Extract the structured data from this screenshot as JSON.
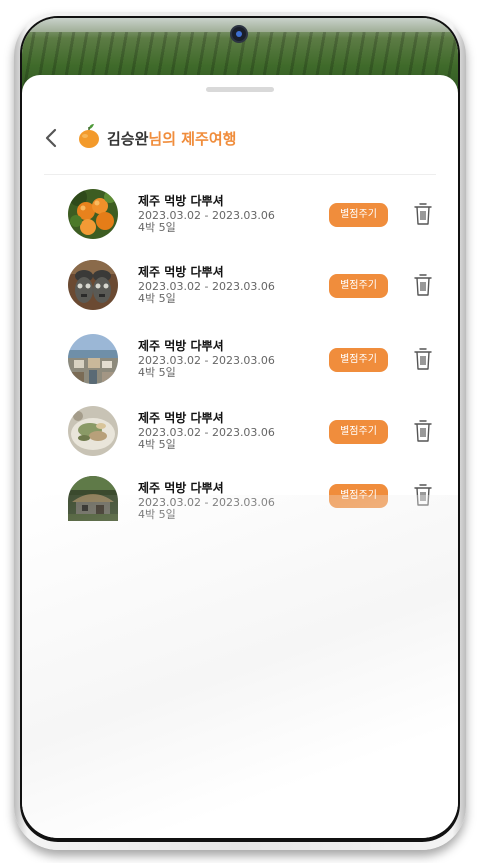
{
  "header": {
    "user_name": "김승완",
    "title_suffix": "님의 제주여행",
    "back_icon": "chevron-left-icon",
    "logo_icon": "tangerine-icon"
  },
  "trips": [
    {
      "title": "제주 먹방 다뿌셔",
      "dates": "2023.03.02 - 2023.03.06",
      "nights": "4박 5일",
      "rate_label": "별점주기",
      "image": "tangerines-photo"
    },
    {
      "title": "제주 먹방 다뿌셔",
      "dates": "2023.03.02 - 2023.03.06",
      "nights": "4박 5일",
      "rate_label": "별점주기",
      "image": "dol-hareubang-photo"
    },
    {
      "title": "제주 먹방 다뿌셔",
      "dates": "2023.03.02 - 2023.03.06",
      "nights": "4박 5일",
      "rate_label": "별점주기",
      "image": "coastal-town-photo"
    },
    {
      "title": "제주 먹방 다뿌셔",
      "dates": "2023.03.02 - 2023.03.06",
      "nights": "4박 5일",
      "rate_label": "별점주기",
      "image": "seafood-dish-photo"
    },
    {
      "title": "제주 먹방 다뿌셔",
      "dates": "2023.03.02 - 2023.03.06",
      "nights": "4박 5일",
      "rate_label": "별점주기",
      "image": "thatched-house-photo"
    }
  ],
  "colors": {
    "accent": "#f08d3c",
    "title_text": "#333333",
    "secondary_text": "#666666"
  }
}
